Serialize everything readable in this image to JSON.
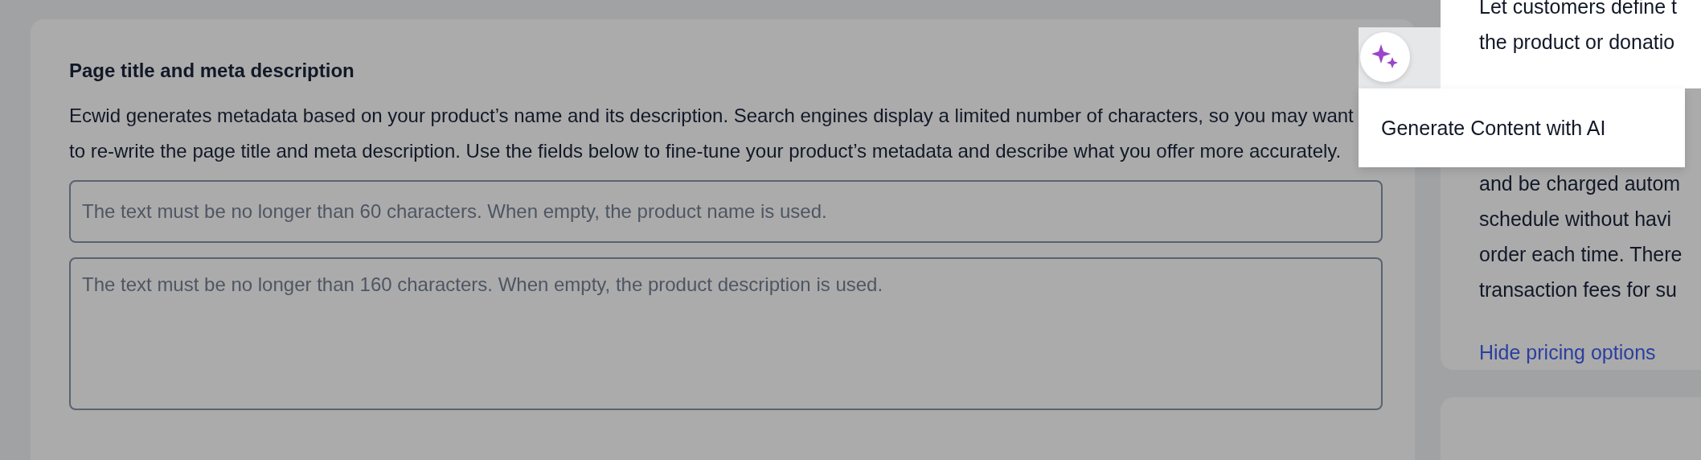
{
  "main_card": {
    "title": "Page title and meta description",
    "description": "Ecwid generates metadata based on your product’s name and its description. Search engines display a limited number of characters, so you may want to re-write the page title and meta description. Use the fields below to fine-tune your product’s metadata and describe what you offer more accurately.",
    "fields": [
      {
        "kind": "input",
        "placeholder": "The text must be no longer than 60 characters. When empty, the product name is used."
      },
      {
        "kind": "textarea",
        "placeholder": "The text must be no longer than 160 characters. When empty, the product description is used."
      }
    ]
  },
  "side_panel": {
    "highlighted_lines": [
      "Let customers define t",
      "the product or donatio"
    ],
    "lines": [
      "and be charged autom",
      "schedule without havi",
      "order each time. There",
      "transaction fees for su"
    ],
    "link": "Hide pricing options"
  },
  "ai_popup": {
    "menu_item": "Generate Content with AI"
  }
}
